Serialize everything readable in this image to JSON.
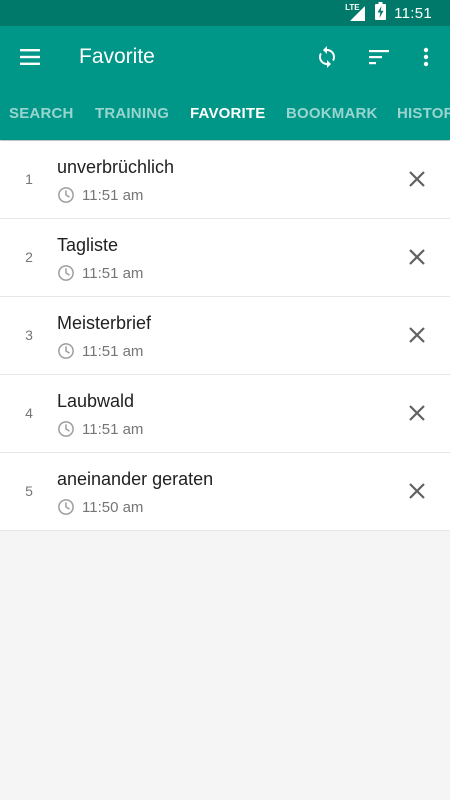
{
  "status_bar": {
    "network_label": "LTE",
    "time": "11:51"
  },
  "app_bar": {
    "title": "Favorite",
    "menu_icon": "hamburger-menu-icon",
    "actions": [
      {
        "icon": "refresh-icon"
      },
      {
        "icon": "sort-icon"
      },
      {
        "icon": "more-vertical-icon"
      }
    ]
  },
  "tabs": [
    {
      "label": "SEARCH",
      "active": false
    },
    {
      "label": "TRAINING",
      "active": false
    },
    {
      "label": "FAVORITE",
      "active": true
    },
    {
      "label": "BOOKMARK",
      "active": false
    },
    {
      "label": "HISTORY",
      "active": false
    }
  ],
  "favorites": [
    {
      "index": "1",
      "word": "unverbrüchlich",
      "time": "11:51 am"
    },
    {
      "index": "2",
      "word": "Tagliste",
      "time": "11:51 am"
    },
    {
      "index": "3",
      "word": "Meisterbrief",
      "time": "11:51 am"
    },
    {
      "index": "4",
      "word": "Laubwald",
      "time": "11:51 am"
    },
    {
      "index": "5",
      "word": "aneinander geraten",
      "time": "11:50 am"
    }
  ],
  "colors": {
    "status_bar": "#00796b",
    "primary": "#009688",
    "tab_inactive_text": "rgba(255,255,255,0.6)",
    "background": "#f5f5f5",
    "secondary_text": "#757575"
  }
}
